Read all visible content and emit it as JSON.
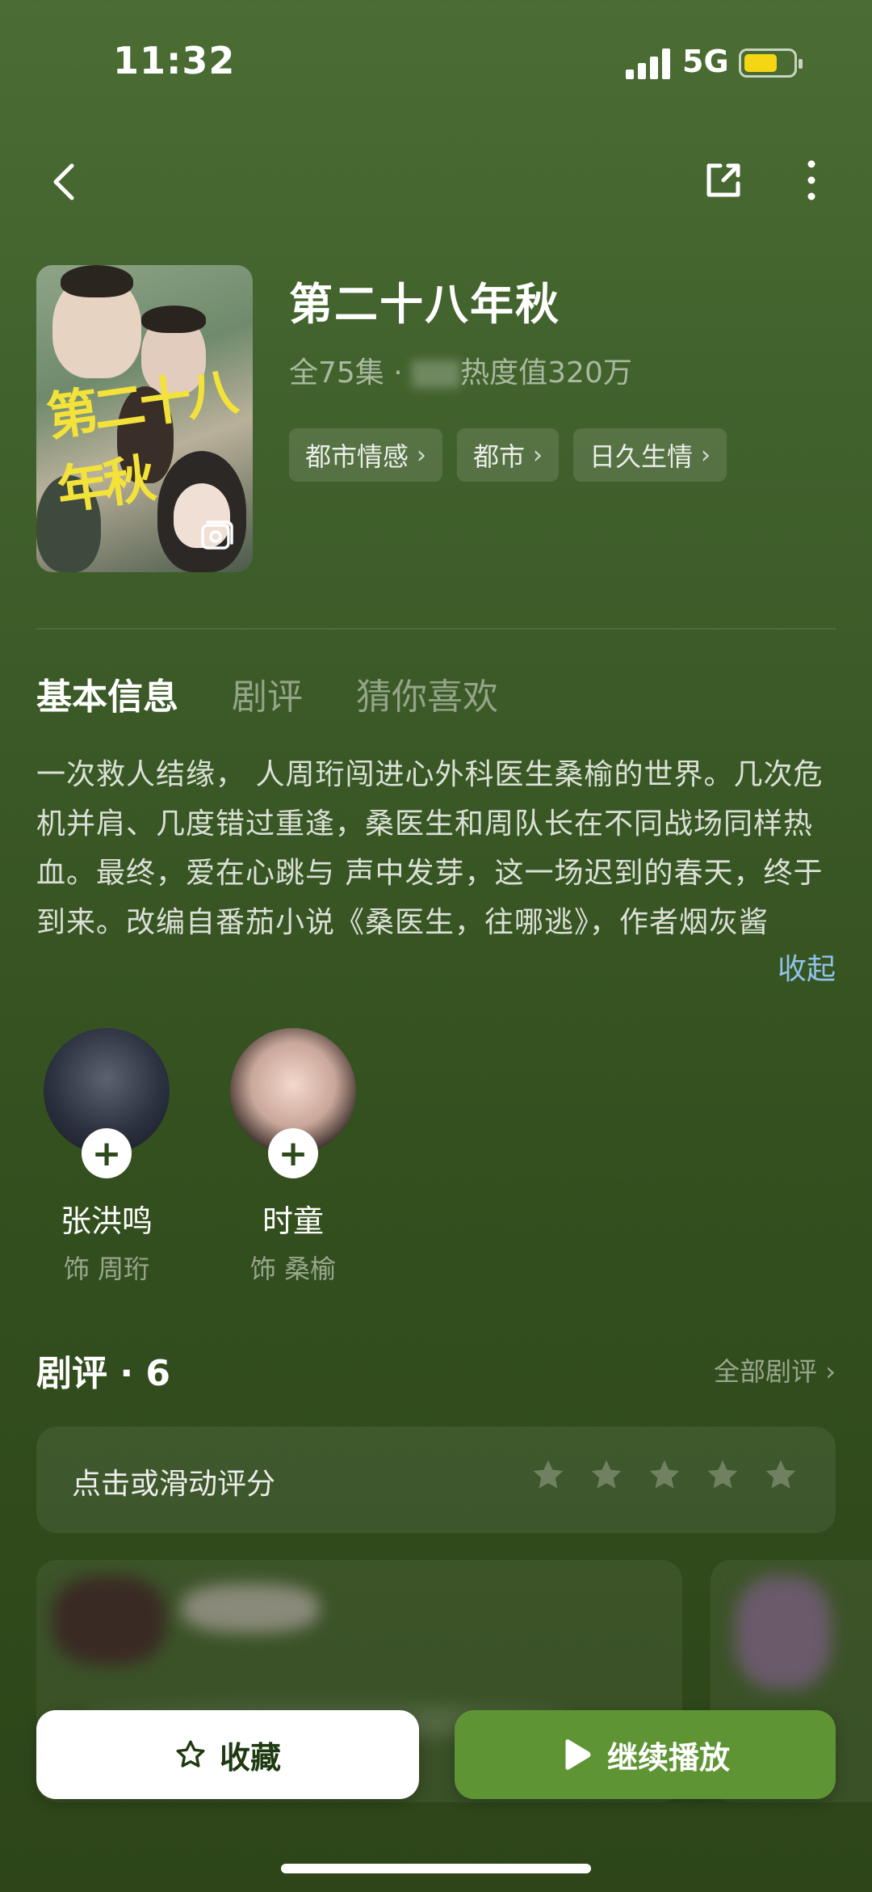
{
  "status_bar": {
    "time": "11:32",
    "network": "5G",
    "battery_color": "#f5d614"
  },
  "icons": {
    "back": "back-arrow-icon",
    "share": "share-icon",
    "more": "more-vertical-icon",
    "gallery": "gallery-icon",
    "follow": "plus-icon",
    "star": "star-icon",
    "play": "play-icon",
    "favorite": "star-outline-icon"
  },
  "drama": {
    "title": "第二十八年秋",
    "meta_episodes": "全75集 · ",
    "meta_heat": "热度值320万",
    "tags": [
      {
        "label": "都市情感"
      },
      {
        "label": "都市"
      },
      {
        "label": "日久生情"
      }
    ],
    "poster_title_art": "第二十八年秋"
  },
  "tabs": [
    {
      "label": "基本信息",
      "active": true
    },
    {
      "label": "剧评",
      "active": false
    },
    {
      "label": "猜你喜欢",
      "active": false
    }
  ],
  "synopsis": {
    "text": "一次救人结缘，  人周珩闯进心外科医生桑榆的世界。几次危机并肩、几度错过重逢，桑医生和周队长在不同战场同样热血。最终，爱在心跳与 声中发芽，这一场迟到的春天，终于到来。改编自番茄小说《桑医生，往哪逃》，作者烟灰酱",
    "collapse_label": "收起"
  },
  "cast": [
    {
      "name": "张洪鸣",
      "role": "饰 周珩"
    },
    {
      "name": "时童",
      "role": "饰 桑榆"
    }
  ],
  "reviews": {
    "title": "剧评 · 6",
    "all_label": "全部剧评",
    "rate_prompt": "点击或滑动评分",
    "star_count": 5
  },
  "actions": {
    "favorite_label": "收藏",
    "play_label": "继续播放",
    "play_color": "#5e9433"
  }
}
